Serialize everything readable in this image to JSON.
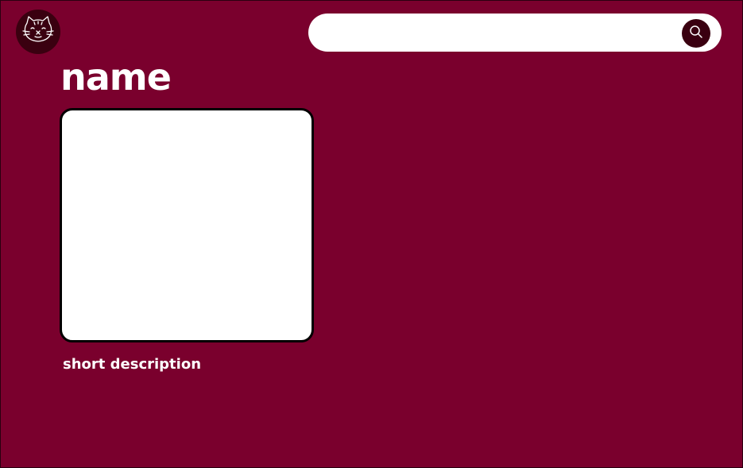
{
  "header": {
    "logo_icon": "cat-face-icon",
    "search": {
      "placeholder": "",
      "value": "",
      "button_icon": "search-icon"
    }
  },
  "main": {
    "title": "name",
    "image_placeholder": "",
    "description": "short description"
  },
  "colors": {
    "background": "#7a002d",
    "accent_dark": "#3a0010",
    "surface": "#ffffff",
    "border": "#000000"
  }
}
